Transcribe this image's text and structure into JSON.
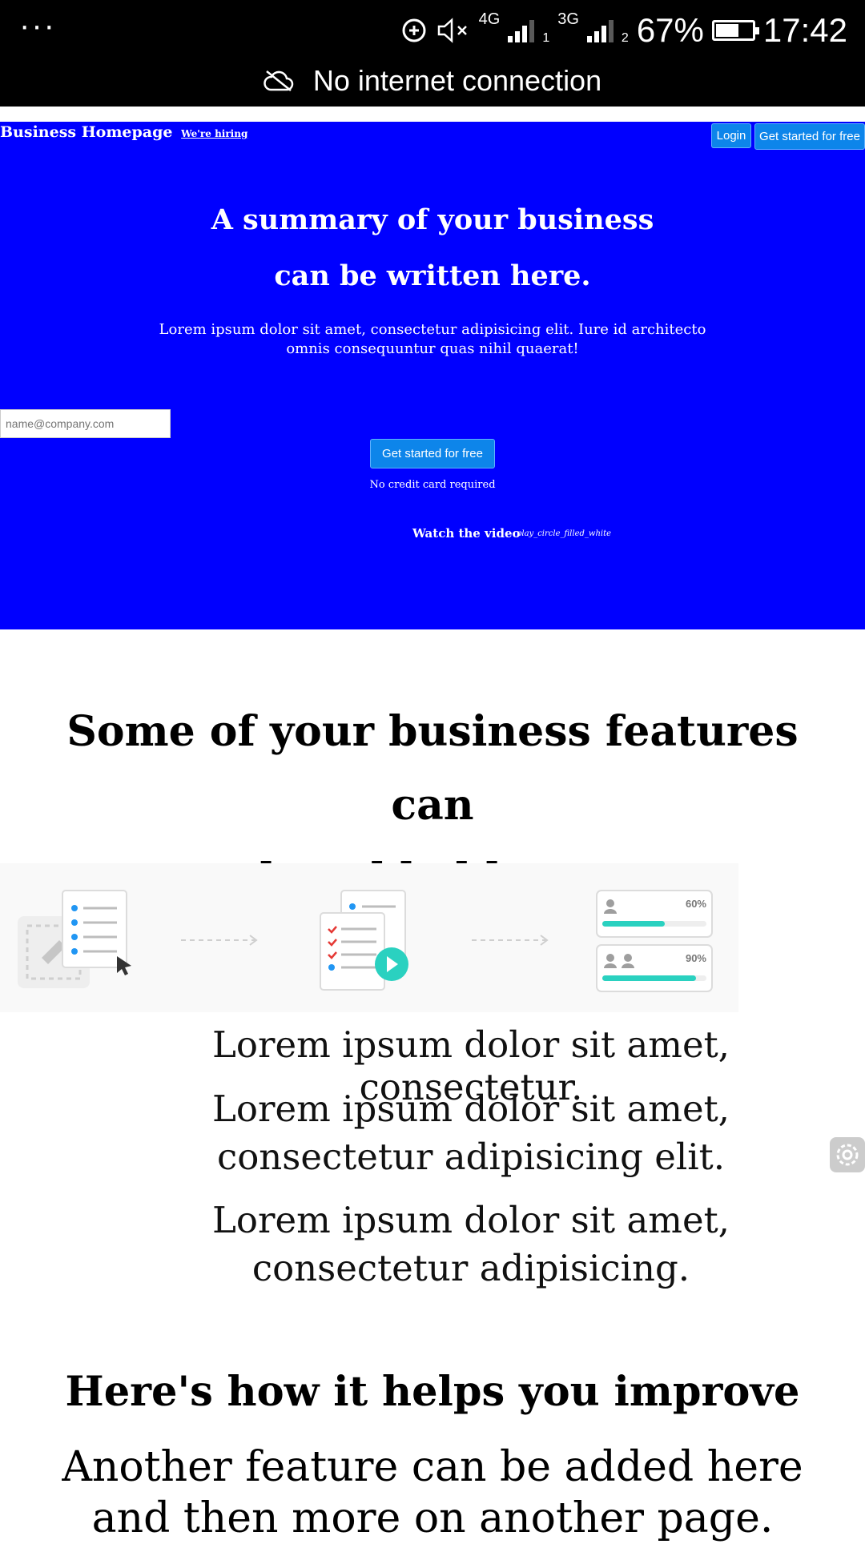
{
  "status_bar": {
    "menu": "···",
    "network_primary": "4G",
    "sim_primary": "1",
    "network_secondary": "3G",
    "sim_secondary": "2",
    "battery": "67%",
    "battery_level": 0.67,
    "time": "17:42",
    "notice": "No internet connection"
  },
  "header": {
    "brand": "Business Homepage",
    "hiring": "We're hiring",
    "login": "Login",
    "get_started": "Get started for free"
  },
  "hero": {
    "headline_line1": "A summary of your business",
    "headline_line2": "can be written here.",
    "lead": "Lorem ipsum dolor sit amet, consectetur adipisicing elit. Iure id architecto omnis consequuntur quas nihil quaerat!",
    "email_placeholder": "name@company.com",
    "cta": "Get started for free",
    "no_card": "No credit card required",
    "watch": "Watch the video",
    "play_icon": "play_circle_filled_white"
  },
  "features": {
    "title_line1": "Some of your business features can",
    "title_line2": "be added here.",
    "illustration": {
      "percent1": "60%",
      "percent2": "90%",
      "progress1": 0.6,
      "progress2": 0.9
    },
    "items": [
      "Lorem ipsum dolor sit amet, consectetur.",
      "Lorem ipsum dolor sit amet, consectetur adipisicing elit.",
      "Lorem ipsum dolor sit amet, consectetur adipisicing."
    ]
  },
  "improve": {
    "title": "Here's how it helps you improve",
    "text": "Another feature can be added here and then more on another page."
  },
  "colors": {
    "hero_bg": "#0000ff",
    "button": "#0d85ea",
    "accent": "#2ad1c0"
  }
}
